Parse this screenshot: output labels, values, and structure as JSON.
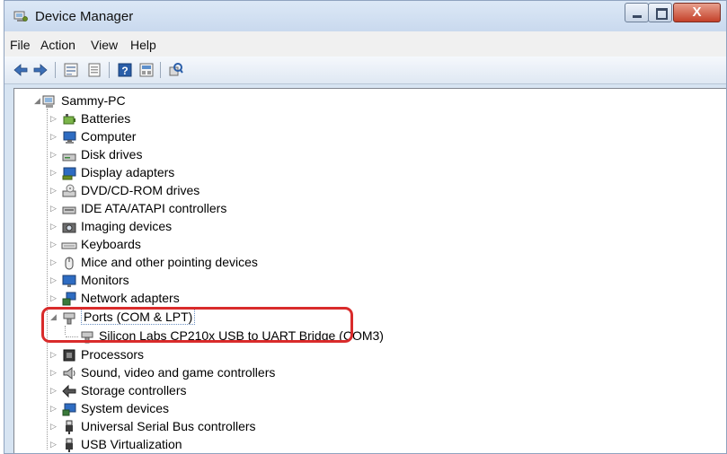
{
  "window": {
    "title": "Device Manager",
    "icons": {
      "app": "device-manager-icon",
      "minimize": "minimize-icon",
      "maximize": "maximize-icon",
      "close": "close-icon"
    },
    "close_glyph": "X"
  },
  "menu": {
    "file": "File",
    "action": "Action",
    "view": "View",
    "help": "Help"
  },
  "toolbar": {
    "icons": [
      "back-arrow-icon",
      "forward-arrow-icon",
      "properties-icon",
      "update-driver-icon",
      "help-icon",
      "show-hidden-icon",
      "scan-hardware-icon"
    ]
  },
  "tree": {
    "root": {
      "label": "Sammy-PC",
      "icon": "computer-icon",
      "expanded": true
    },
    "categories": [
      {
        "label": "Batteries",
        "icon": "battery-icon"
      },
      {
        "label": "Computer",
        "icon": "computer-monitor-icon"
      },
      {
        "label": "Disk drives",
        "icon": "disk-drive-icon"
      },
      {
        "label": "Display adapters",
        "icon": "display-adapter-icon"
      },
      {
        "label": "DVD/CD-ROM drives",
        "icon": "dvd-drive-icon"
      },
      {
        "label": "IDE ATA/ATAPI controllers",
        "icon": "ide-controller-icon"
      },
      {
        "label": "Imaging devices",
        "icon": "imaging-device-icon"
      },
      {
        "label": "Keyboards",
        "icon": "keyboard-icon"
      },
      {
        "label": "Mice and other pointing devices",
        "icon": "mouse-icon"
      },
      {
        "label": "Monitors",
        "icon": "monitor-icon"
      },
      {
        "label": "Network adapters",
        "icon": "network-adapter-icon"
      },
      {
        "label": "Ports (COM & LPT)",
        "icon": "port-icon",
        "expanded": true,
        "children": [
          {
            "label": "Silicon Labs CP210x USB to UART Bridge (COM3)",
            "icon": "port-icon"
          }
        ]
      },
      {
        "label": "Processors",
        "icon": "processor-icon"
      },
      {
        "label": "Sound, video and game controllers",
        "icon": "speaker-icon"
      },
      {
        "label": "Storage controllers",
        "icon": "storage-controller-icon"
      },
      {
        "label": "System devices",
        "icon": "system-device-icon"
      },
      {
        "label": "Universal Serial Bus controllers",
        "icon": "usb-icon"
      },
      {
        "label": "USB Virtualization",
        "icon": "usb-icon"
      }
    ]
  },
  "highlight": {
    "color": "#d92b2b",
    "target": "Ports (COM & LPT)"
  }
}
